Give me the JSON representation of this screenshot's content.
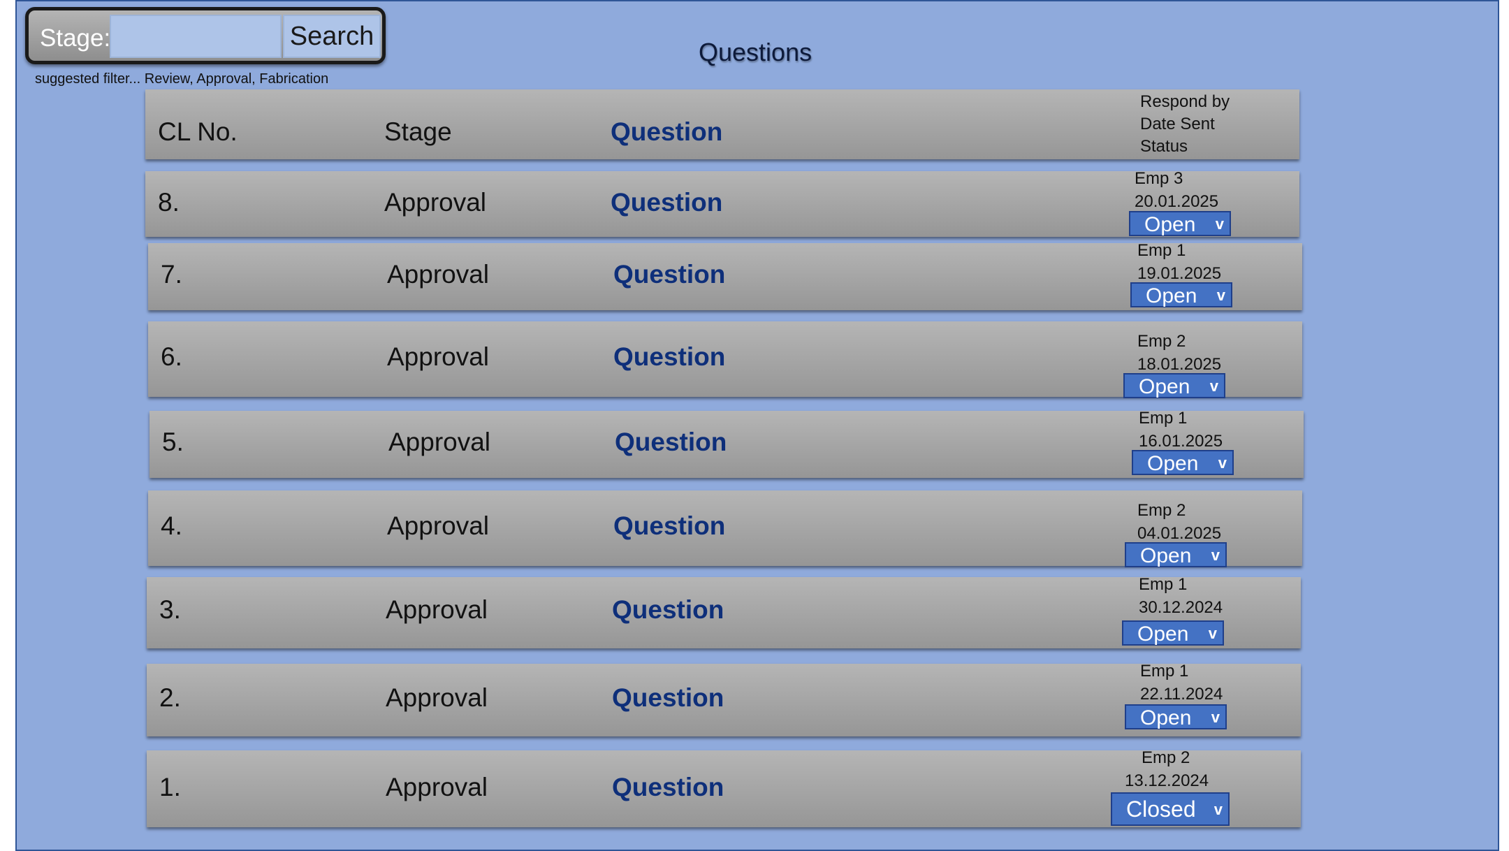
{
  "search": {
    "label": "Stage:",
    "value": "",
    "placeholder": "",
    "button_label": "Search",
    "hint": "suggested filter... Review, Approval, Fabrication"
  },
  "page_title": "Questions",
  "colors": {
    "background": "#8faadc",
    "row_fill": "#a6a6a6",
    "question_text": "#0e2f7a",
    "status_button": "#4472c4"
  },
  "header": {
    "cl_no": "CL No.",
    "stage": "Stage",
    "question": "Question",
    "respond_by": "Respond by",
    "date_sent": "Date Sent",
    "status": "Status"
  },
  "chevron_glyph": "v",
  "rows": [
    {
      "no": "8.",
      "stage": "Approval",
      "question": "Question",
      "emp": "Emp  3",
      "date": "20.01.2025",
      "status": "Open"
    },
    {
      "no": "7.",
      "stage": "Approval",
      "question": "Question",
      "emp": "Emp  1",
      "date": "19.01.2025",
      "status": "Open"
    },
    {
      "no": "6.",
      "stage": "Approval",
      "question": "Question",
      "emp": "Emp  2",
      "date": "18.01.2025",
      "status": "Open"
    },
    {
      "no": "5.",
      "stage": "Approval",
      "question": "Question",
      "emp": "Emp  1",
      "date": "16.01.2025",
      "status": "Open"
    },
    {
      "no": "4.",
      "stage": "Approval",
      "question": "Question",
      "emp": "Emp  2",
      "date": "04.01.2025",
      "status": "Open"
    },
    {
      "no": "3.",
      "stage": "Approval",
      "question": "Question",
      "emp": "Emp  1",
      "date": "30.12.2024",
      "status": "Open"
    },
    {
      "no": "2.",
      "stage": "Approval",
      "question": "Question",
      "emp": "Emp  1",
      "date": "22.11.2024",
      "status": "Open"
    },
    {
      "no": "1.",
      "stage": "Approval",
      "question": "Question",
      "emp": "Emp  2",
      "date": "13.12.2024",
      "status": "Closed"
    }
  ]
}
